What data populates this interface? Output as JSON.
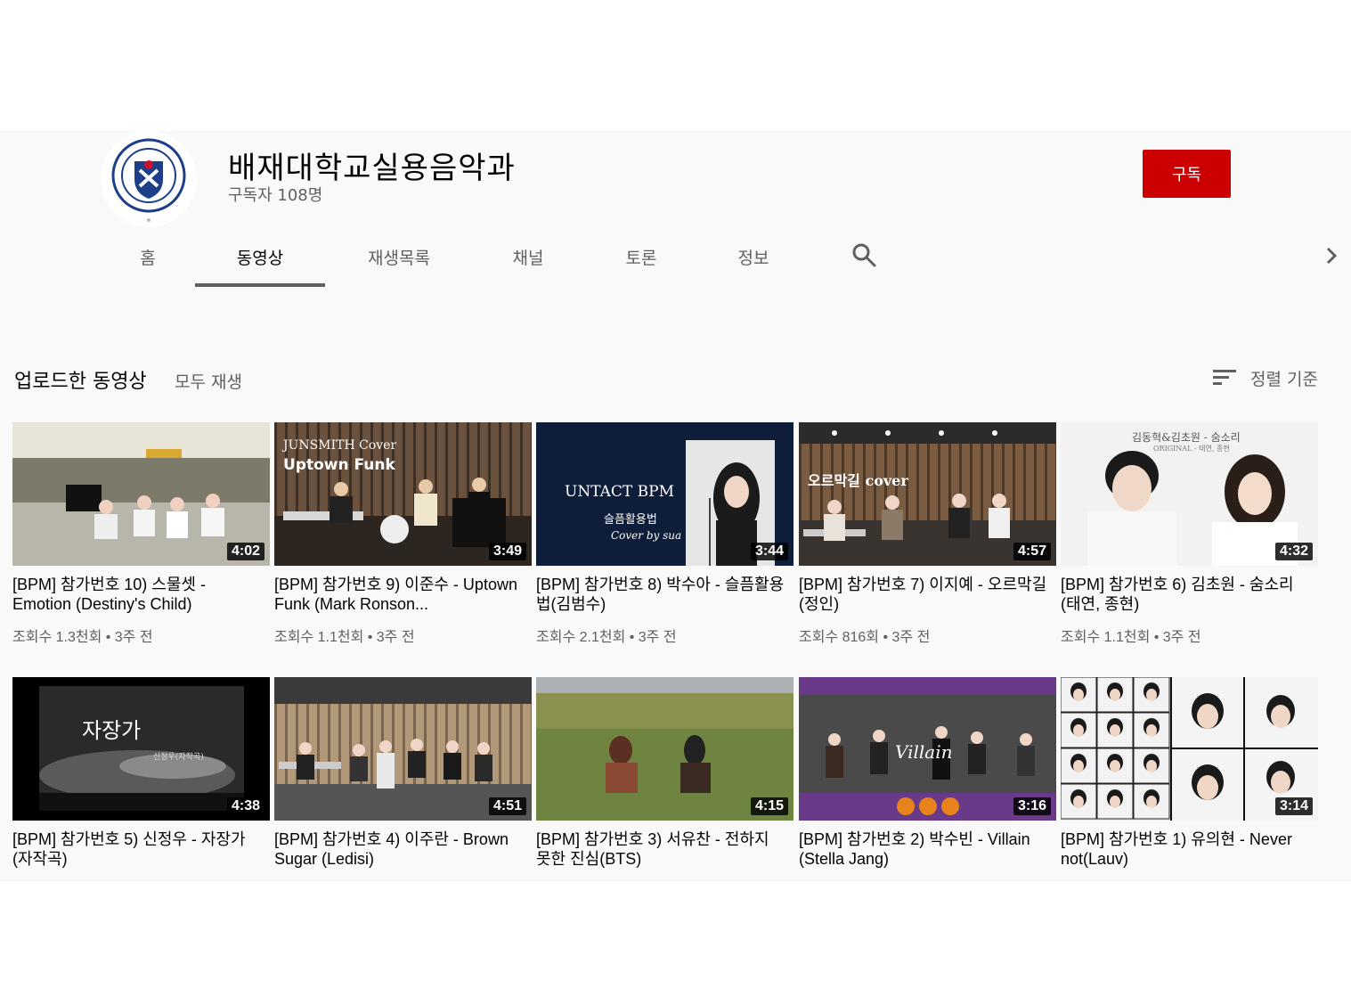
{
  "channel": {
    "name": "배재대학교실용음악과",
    "subscribers": "구독자 108명",
    "subscribe_label": "구독",
    "avatar_text": "PAI CHAI UNIVERSITY"
  },
  "tabs": [
    {
      "label": "홈"
    },
    {
      "label": "동영상"
    },
    {
      "label": "재생목록"
    },
    {
      "label": "채널"
    },
    {
      "label": "토론"
    },
    {
      "label": "정보"
    }
  ],
  "icons": {
    "search": "search-icon",
    "next": "chevron-right-icon",
    "sort": "sort-icon"
  },
  "section": {
    "title": "업로드한 동영상",
    "play_all": "모두 재생",
    "sort_label": "정렬 기준"
  },
  "colors": {
    "subscribe_bg": "#cc0000",
    "background": "#f9f9f9"
  },
  "videos": [
    {
      "title": "[BPM] 참가번호 10) 스물셋 - Emotion (Destiny's Child)",
      "meta": "조회수 1.3천회 • 3주 전",
      "duration": "4:02",
      "thumb_text": ""
    },
    {
      "title": "[BPM] 참가번호 9) 이준수 - Uptown Funk (Mark Ronson...",
      "meta": "조회수 1.1천회 • 3주 전",
      "duration": "3:49",
      "thumb_text": "JUNSMITH Cover",
      "thumb_text2": "Uptown Funk"
    },
    {
      "title": "[BPM] 참가번호 8) 박수아 - 슬픔활용법(김범수)",
      "meta": "조회수 2.1천회 • 3주 전",
      "duration": "3:44",
      "thumb_text": "UNTACT BPM",
      "thumb_text2": "슬픔활용법",
      "thumb_text3": "Cover by sua"
    },
    {
      "title": "[BPM] 참가번호 7) 이지예 - 오르막길 (정인)",
      "meta": "조회수 816회 • 3주 전",
      "duration": "4:57",
      "thumb_text": "오르막길 cover"
    },
    {
      "title": "[BPM] 참가번호 6) 김초원 - 숨소리 (태연, 종현)",
      "meta": "조회수 1.1천회 • 3주 전",
      "duration": "4:32",
      "thumb_text": "김동혁&김초원 - 숨소리",
      "thumb_text2": "ORIGINAL - 태연, 종현"
    },
    {
      "title": "[BPM] 참가번호 5) 신정우 - 자장가 (자작곡)",
      "meta": "",
      "duration": "4:38",
      "thumb_text": "자장가",
      "thumb_text2": "신정우(자작곡)"
    },
    {
      "title": "[BPM] 참가번호 4) 이주란 - Brown Sugar (Ledisi)",
      "meta": "",
      "duration": "4:51",
      "thumb_text": ""
    },
    {
      "title": "[BPM] 참가번호 3) 서유찬 - 전하지 못한 진심(BTS)",
      "meta": "",
      "duration": "4:15",
      "thumb_text": ""
    },
    {
      "title": "[BPM] 참가번호 2) 박수빈 - Villain (Stella Jang)",
      "meta": "",
      "duration": "3:16",
      "thumb_text": "Villain"
    },
    {
      "title": "[BPM] 참가번호 1) 유의현 - Never not(Lauv)",
      "meta": "",
      "duration": "3:14",
      "thumb_text": ""
    }
  ]
}
